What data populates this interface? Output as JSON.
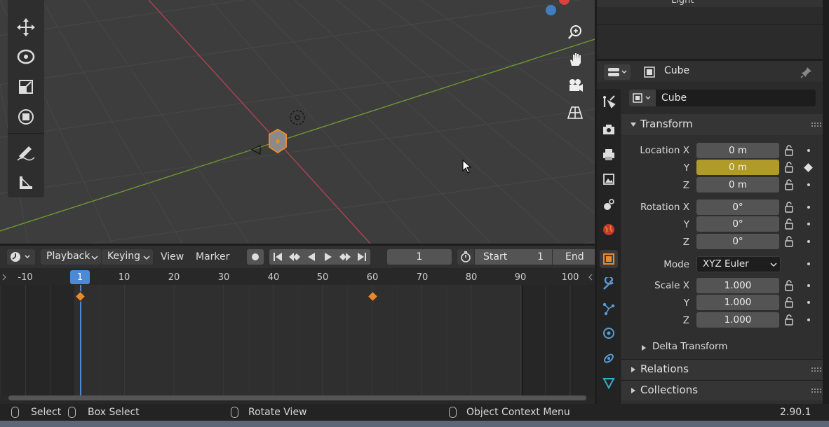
{
  "colors": {
    "accent_orange": "#e8892f",
    "keyframed_yellow": "#b09a2a",
    "x_axis_red": "#b0424f",
    "y_axis_green": "#6d9831",
    "playhead_blue": "#4d8ad6",
    "panel_bg": "#2b2b2b",
    "viewport_bg": "#3d3d3d"
  },
  "outliner": {
    "visible_item": "Light"
  },
  "properties": {
    "header_title": "Cube",
    "object_name": "Cube",
    "transform": {
      "title": "Transform",
      "location": [
        {
          "label": "Location X",
          "value": "0 m"
        },
        {
          "label": "Y",
          "value": "0 m"
        },
        {
          "label": "Z",
          "value": "0 m"
        }
      ],
      "rotation": [
        {
          "label": "Rotation X",
          "value": "0°"
        },
        {
          "label": "Y",
          "value": "0°"
        },
        {
          "label": "Z",
          "value": "0°"
        }
      ],
      "mode_label": "Mode",
      "mode_value": "XYZ Euler",
      "scale": [
        {
          "label": "Scale X",
          "value": "1.000"
        },
        {
          "label": "Y",
          "value": "1.000"
        },
        {
          "label": "Z",
          "value": "1.000"
        }
      ],
      "delta_title": "Delta Transform"
    },
    "relations_title": "Relations",
    "collections_title": "Collections"
  },
  "timeline": {
    "menus": {
      "playback": "Playback",
      "keying": "Keying",
      "view": "View",
      "marker": "Marker"
    },
    "current_frame": "1",
    "start_label": "Start",
    "start_value": "1",
    "end_label": "End",
    "ruler": [
      "-10",
      "1",
      "10",
      "20",
      "30",
      "40",
      "50",
      "60",
      "70",
      "80",
      "90",
      "100"
    ],
    "keyframes": [
      1,
      60
    ]
  },
  "statusbar": {
    "select": "Select",
    "box_select": "Box Select",
    "rotate_view": "Rotate View",
    "context_menu": "Object Context Menu",
    "version": "2.90.1"
  }
}
